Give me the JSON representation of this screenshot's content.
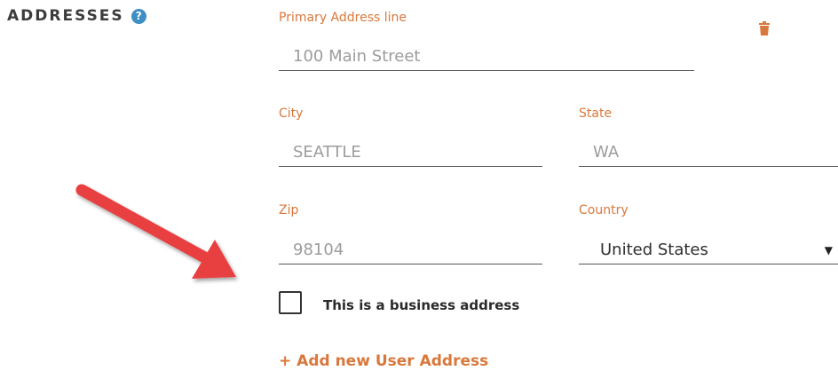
{
  "section": {
    "title": "ADDRESSES",
    "help_icon": "?"
  },
  "address": {
    "primary_label": "Primary Address line",
    "primary_value": "100 Main Street",
    "city_label": "City",
    "city_value": "SEATTLE",
    "state_label": "State",
    "state_value": "WA",
    "zip_label": "Zip",
    "zip_value": "98104",
    "country_label": "Country",
    "country_value": "United States",
    "business_checkbox_label": "This is a business address",
    "business_checked": false
  },
  "actions": {
    "add_address": "+ Add new User Address"
  },
  "icons": {
    "delete": "trash-icon",
    "help": "help-icon",
    "annotation": "red-arrow"
  },
  "colors": {
    "accent": "#d9783c",
    "help": "#3d8fc4",
    "arrow": "#e8403f"
  }
}
